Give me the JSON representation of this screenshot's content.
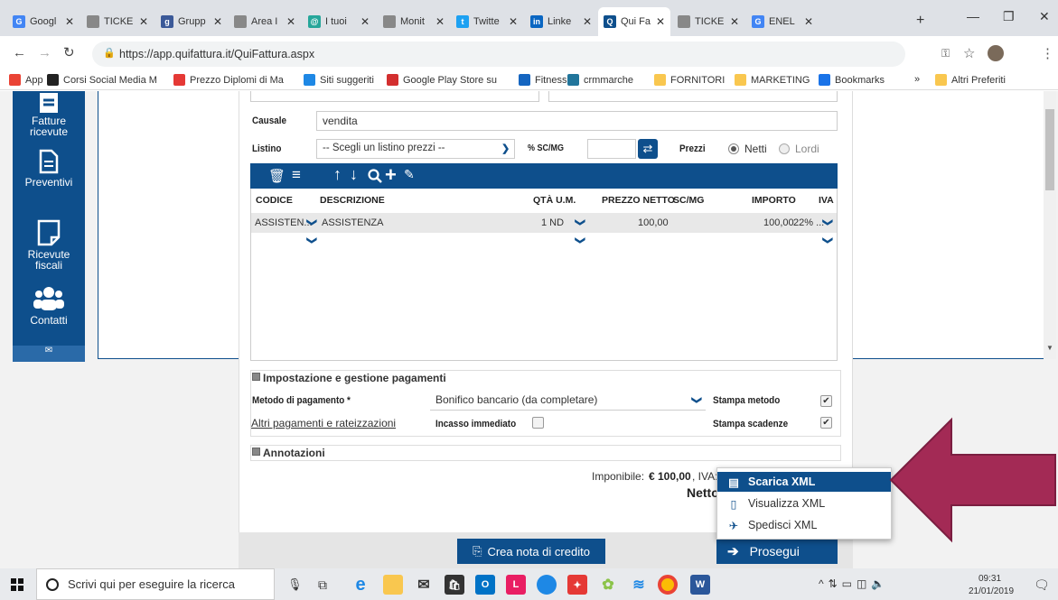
{
  "browser": {
    "tabs": [
      {
        "label": "Googl",
        "fav": "G",
        "color": "#4285f4"
      },
      {
        "label": "TICKE",
        "fav": "",
        "color": "#888"
      },
      {
        "label": "Grupp",
        "fav": "g",
        "color": "#3b5998"
      },
      {
        "label": "Area I",
        "fav": "",
        "color": "#888"
      },
      {
        "label": "I tuoi",
        "fav": "@",
        "color": "#26a69a"
      },
      {
        "label": "Monit",
        "fav": "",
        "color": "#888"
      },
      {
        "label": "Twitte",
        "fav": "t",
        "color": "#1da1f2"
      },
      {
        "label": "Linke",
        "fav": "in",
        "color": "#0a66c2"
      },
      {
        "label": "Qui Fa",
        "fav": "Q",
        "color": "#0e4f8c"
      },
      {
        "label": "TICKE",
        "fav": "",
        "color": "#888"
      },
      {
        "label": "ENEL",
        "fav": "G",
        "color": "#4285f4"
      }
    ],
    "url": "https://app.quifattura.it/QuiFattura.aspx",
    "bookmarks": [
      {
        "label": "App",
        "color": "#ea4335"
      },
      {
        "label": "Corsi Social Media M",
        "color": "#222"
      },
      {
        "label": "Prezzo Diplomi di Ma",
        "color": "#e53935"
      },
      {
        "label": "Siti suggeriti",
        "color": "#1e88e5"
      },
      {
        "label": "Google Play Store su",
        "color": "#d32f2f"
      },
      {
        "label": "Fitness",
        "color": "#1565c0"
      },
      {
        "label": "crmmarche",
        "color": "#21759b"
      },
      {
        "label": "FORNITORI",
        "color": "#f9c74f"
      },
      {
        "label": "MARKETING",
        "color": "#f9c74f"
      },
      {
        "label": "Bookmarks",
        "color": "#1a73e8"
      },
      {
        "label": "Altri Preferiti",
        "color": "#f9c74f"
      }
    ],
    "more": "»"
  },
  "sidebar": {
    "items": [
      "Fatture ricevute",
      "Preventivi",
      "Ricevute fiscali",
      "Contatti"
    ]
  },
  "form": {
    "causale_label": "Causale",
    "causale_value": "vendita",
    "listino_label": "Listino",
    "listino_value": "-- Scegli un listino prezzi --",
    "sc_label": "% SC/MG",
    "prezzi_label": "Prezzi",
    "netti_label": "Netti",
    "lordi_label": "Lordi"
  },
  "table": {
    "headers": [
      "CODICE",
      "DESCRIZIONE",
      "QTÀ U.M.",
      "PREZZO NETTO",
      "SC/MG",
      "IMPORTO",
      "IVA"
    ],
    "row": {
      "codice": "ASSISTEN...",
      "descrizione": "ASSISTENZA",
      "qta": "1 ND",
      "prezzo": "100,00",
      "importo": "100,00",
      "iva": "22% ..."
    }
  },
  "payments": {
    "title": "Impostazione e gestione pagamenti",
    "metodo_label": "Metodo di pagamento *",
    "metodo_value": "Bonifico bancario (da completare)",
    "altri_link": "Altri pagamenti e rateizzazioni",
    "incasso_label": "Incasso immediato",
    "stampa_metodo": "Stampa metodo",
    "stampa_scadenze": "Stampa scadenze"
  },
  "annotazioni": "Annotazioni",
  "totals": {
    "imponibile_label": "Imponibile:",
    "imponibile_value": "€ 100,00",
    "iva_label": ", IVA:",
    "netto_label": "Netto"
  },
  "dropdown": {
    "items": [
      "Scarica XML",
      "Visualizza XML",
      "Spedisci XML"
    ]
  },
  "buttons": {
    "credit_note": "Crea nota di credito",
    "proceed": "Prosegui"
  },
  "taskbar": {
    "search_placeholder": "Scrivi qui per eseguire la ricerca",
    "time": "09:31",
    "date": "21/01/2019"
  },
  "colors": {
    "brand": "#0e4f8c",
    "arrow": "#a32a55"
  }
}
